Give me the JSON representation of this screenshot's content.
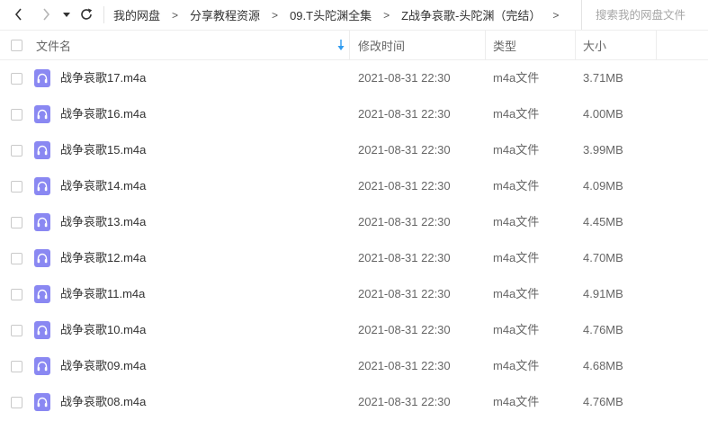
{
  "nav": {
    "back_icon": "chevron-left-icon",
    "forward_icon": "chevron-right-icon",
    "dropdown_icon": "caret-down-icon",
    "refresh_icon": "refresh-icon"
  },
  "breadcrumb": {
    "items": [
      "我的网盘",
      "分享教程资源",
      "09.T头陀渊全集",
      "Z战争哀歌-头陀渊（完结）"
    ],
    "separator": ">"
  },
  "search": {
    "placeholder": "搜索我的网盘文件",
    "value": ""
  },
  "header": {
    "name": "文件名",
    "time": "修改时间",
    "type": "类型",
    "size": "大小",
    "sort_icon": "sort-down-arrow-icon"
  },
  "colors": {
    "audio_icon_bg": "#8a88f2",
    "sort_arrow": "#2e9bf0"
  },
  "files": [
    {
      "name": "战争哀歌17.m4a",
      "time": "2021-08-31 22:30",
      "type": "m4a文件",
      "size": "3.71MB",
      "icon": "audio-file-icon"
    },
    {
      "name": "战争哀歌16.m4a",
      "time": "2021-08-31 22:30",
      "type": "m4a文件",
      "size": "4.00MB",
      "icon": "audio-file-icon"
    },
    {
      "name": "战争哀歌15.m4a",
      "time": "2021-08-31 22:30",
      "type": "m4a文件",
      "size": "3.99MB",
      "icon": "audio-file-icon"
    },
    {
      "name": "战争哀歌14.m4a",
      "time": "2021-08-31 22:30",
      "type": "m4a文件",
      "size": "4.09MB",
      "icon": "audio-file-icon"
    },
    {
      "name": "战争哀歌13.m4a",
      "time": "2021-08-31 22:30",
      "type": "m4a文件",
      "size": "4.45MB",
      "icon": "audio-file-icon"
    },
    {
      "name": "战争哀歌12.m4a",
      "time": "2021-08-31 22:30",
      "type": "m4a文件",
      "size": "4.70MB",
      "icon": "audio-file-icon"
    },
    {
      "name": "战争哀歌11.m4a",
      "time": "2021-08-31 22:30",
      "type": "m4a文件",
      "size": "4.91MB",
      "icon": "audio-file-icon"
    },
    {
      "name": "战争哀歌10.m4a",
      "time": "2021-08-31 22:30",
      "type": "m4a文件",
      "size": "4.76MB",
      "icon": "audio-file-icon"
    },
    {
      "name": "战争哀歌09.m4a",
      "time": "2021-08-31 22:30",
      "type": "m4a文件",
      "size": "4.68MB",
      "icon": "audio-file-icon"
    },
    {
      "name": "战争哀歌08.m4a",
      "time": "2021-08-31 22:30",
      "type": "m4a文件",
      "size": "4.76MB",
      "icon": "audio-file-icon"
    }
  ]
}
